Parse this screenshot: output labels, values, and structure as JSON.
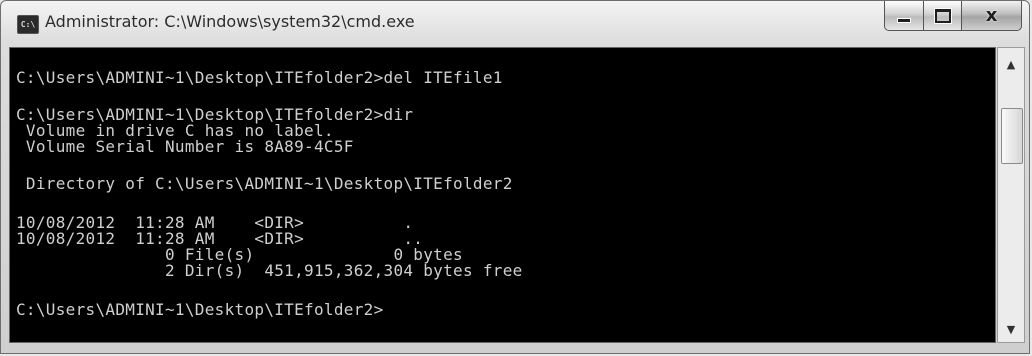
{
  "window": {
    "title": "Administrator: C:\\Windows\\system32\\cmd.exe",
    "icon": "cmd-icon",
    "icon_text": "C:\\",
    "buttons": {
      "minimize": "minimize-icon",
      "maximize": "maximize-icon",
      "close": "close-icon",
      "close_glyph": "x"
    }
  },
  "console": {
    "lines": [
      "C:\\Users\\ADMINI~1\\Desktop\\ITEfolder2>del ITEfile1",
      "C:\\Users\\ADMINI~1\\Desktop\\ITEfolder2>dir",
      " Volume in drive C has no label.",
      " Volume Serial Number is 8A89-4C5F",
      " Directory of C:\\Users\\ADMINI~1\\Desktop\\ITEfolder2",
      "10/08/2012  11:28 AM    <DIR>          .",
      "10/08/2012  11:28 AM    <DIR>          ..",
      "               0 File(s)              0 bytes",
      "               2 Dir(s)  451,915,362,304 bytes free",
      "C:\\Users\\ADMINI~1\\Desktop\\ITEfolder2>"
    ],
    "text_color": "#cfcfcf",
    "background": "#000000"
  },
  "scrollbar": {
    "up_arrow": "▲",
    "down_arrow": "▼"
  }
}
